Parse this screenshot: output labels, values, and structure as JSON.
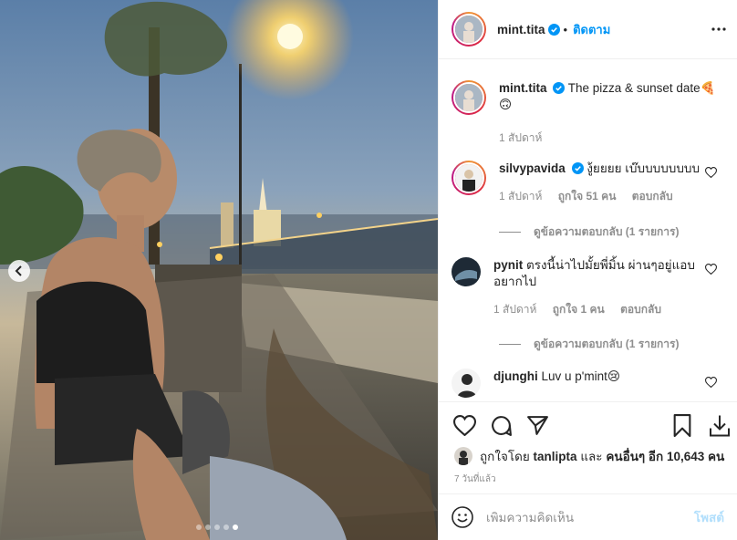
{
  "post": {
    "author": "mint.tita",
    "follow_label": "ติดตาม",
    "caption": "The pizza & sunset date🍕🙃",
    "caption_time": "1 สัปดาห์",
    "photo_alt": "Woman smiling at sunset next to a river with a lit bridge and temple in background"
  },
  "comments": [
    {
      "username": "silvypavida",
      "verified": true,
      "text": "งู้ยยยย เบ๊บบบบบบบบ",
      "time": "1 สัปดาห์",
      "likes": "ถูกใจ 51 คน",
      "reply_label": "ตอบกลับ",
      "view_replies": "ดูข้อความตอบกลับ (1 รายการ)"
    },
    {
      "username": "pynit",
      "verified": false,
      "text": "ตรงนี้น่าไปมั้ยพี่มิ้น ผ่านๆอยู่แอบอยากไป",
      "time": "1 สัปดาห์",
      "likes": "ถูกใจ 1 คน",
      "reply_label": "ตอบกลับ",
      "view_replies": "ดูข้อความตอบกลับ (1 รายการ)"
    },
    {
      "username": "djunghi",
      "verified": false,
      "text": "Luv u p'mint😢"
    }
  ],
  "likes_summary": {
    "prefix": "ถูกใจโดย",
    "user": "tanlipta",
    "and": "และ",
    "others": "คนอื่นๆ อีก 10,643 คน"
  },
  "posted_ago": "7 วันที่แล้ว",
  "add_comment": {
    "placeholder": "เพิ่มความคิดเห็น",
    "post_label": "โพสต์"
  },
  "carousel": {
    "total": 5,
    "active_index": 4
  },
  "colors": {
    "accent": "#0095f6",
    "muted": "#8e8e8e",
    "text": "#262626",
    "divider": "#efefef"
  },
  "icons": [
    "chevron-left-icon",
    "verified-badge-icon",
    "more-icon",
    "heart-icon",
    "comment-icon",
    "share-icon",
    "bookmark-icon",
    "emoji-icon"
  ]
}
